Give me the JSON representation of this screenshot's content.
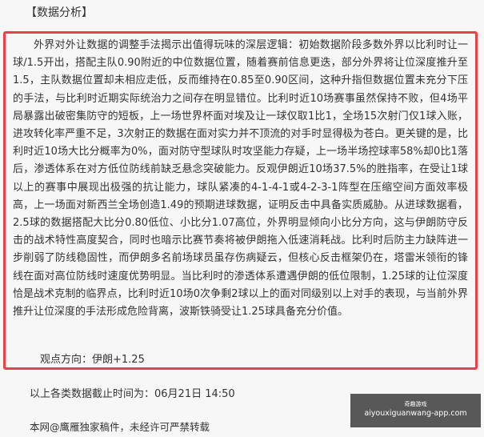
{
  "section_title": "【数据分析】",
  "analysis": {
    "paragraph": "外界对外让数据的调整手法揭示出值得玩味的深层逻辑：初始数据阶段多数外界以比利时让一球/1.5开出，搭配主队0.90附近的中位数据位置，随着赛前信息更迭，部分外界将让位深度推升至1.5，主队数据位置却未相应走低，反而维持在0.85至0.90区间，这种升指但数据位置未充分下压的手法，与比利时近期实际统治力之间存在明显错位。比利时近10场赛事虽然保持不败，但4场平局暴露出破密集防守的短板，上一场世界杯面对埃及让一球仅取1比1，全场15次射门仅1球入账，进攻转化率严重不足，3次射正的数据在面对实力并不顶流的对手时显得极为苍白。更关键的是，比利时近10场大比分概率为0%，面对防守型球队时攻坚能力存疑，上一场半场控球率58%却0比1落后，渗透体系在对方低位防线前缺乏悬念突破能力。反观伊朗近10场37.5%的胜指率，在受让1球以上的赛事中展现出极强的抗让能力，球队紧凑的4-1-4-1或4-2-3-1阵型在压缩空间方面效率极高，上一场面对新西兰全场创造1.49的预期进球数据，证明反击中具备实质威胁。从进球数据看，2.5球的数据搭配大比分0.80低位、小比分1.07高位，外界明显倾向小比分方向，这与伊朗防守反击的战术特性高度契合，同时也暗示比赛节奏将被伊朗拖入低速消耗战。比利时后防主力缺阵进一步削弱了防线稳固性，而伊朗多名前场球员虽存伤病疑云，但核心反击框架仍在，塔雷米领衔的锋线在面对高位防线时速度优势明显。当比利时的渗透体系遭遇伊朗的低位限制，1.25球的让位深度恰是战术克制的临界点，比利时近10场0次争剩2球以上的面对同级别以上对手的表现，与当前外界推升让位深度的手法形成危险背离，波斯铁骑受让1.25球具备充分价值。",
    "view_label": "观点方向：伊朗+1.25"
  },
  "footer": {
    "cutoff": "以上各类数据截止时间为：06月21日 14:50",
    "copyright": "本网@鹰雁独家稿件，未经许可严禁转载"
  },
  "watermark": {
    "top": "奇趣游戏",
    "site": "aiyouxiguanwang-app.com"
  }
}
